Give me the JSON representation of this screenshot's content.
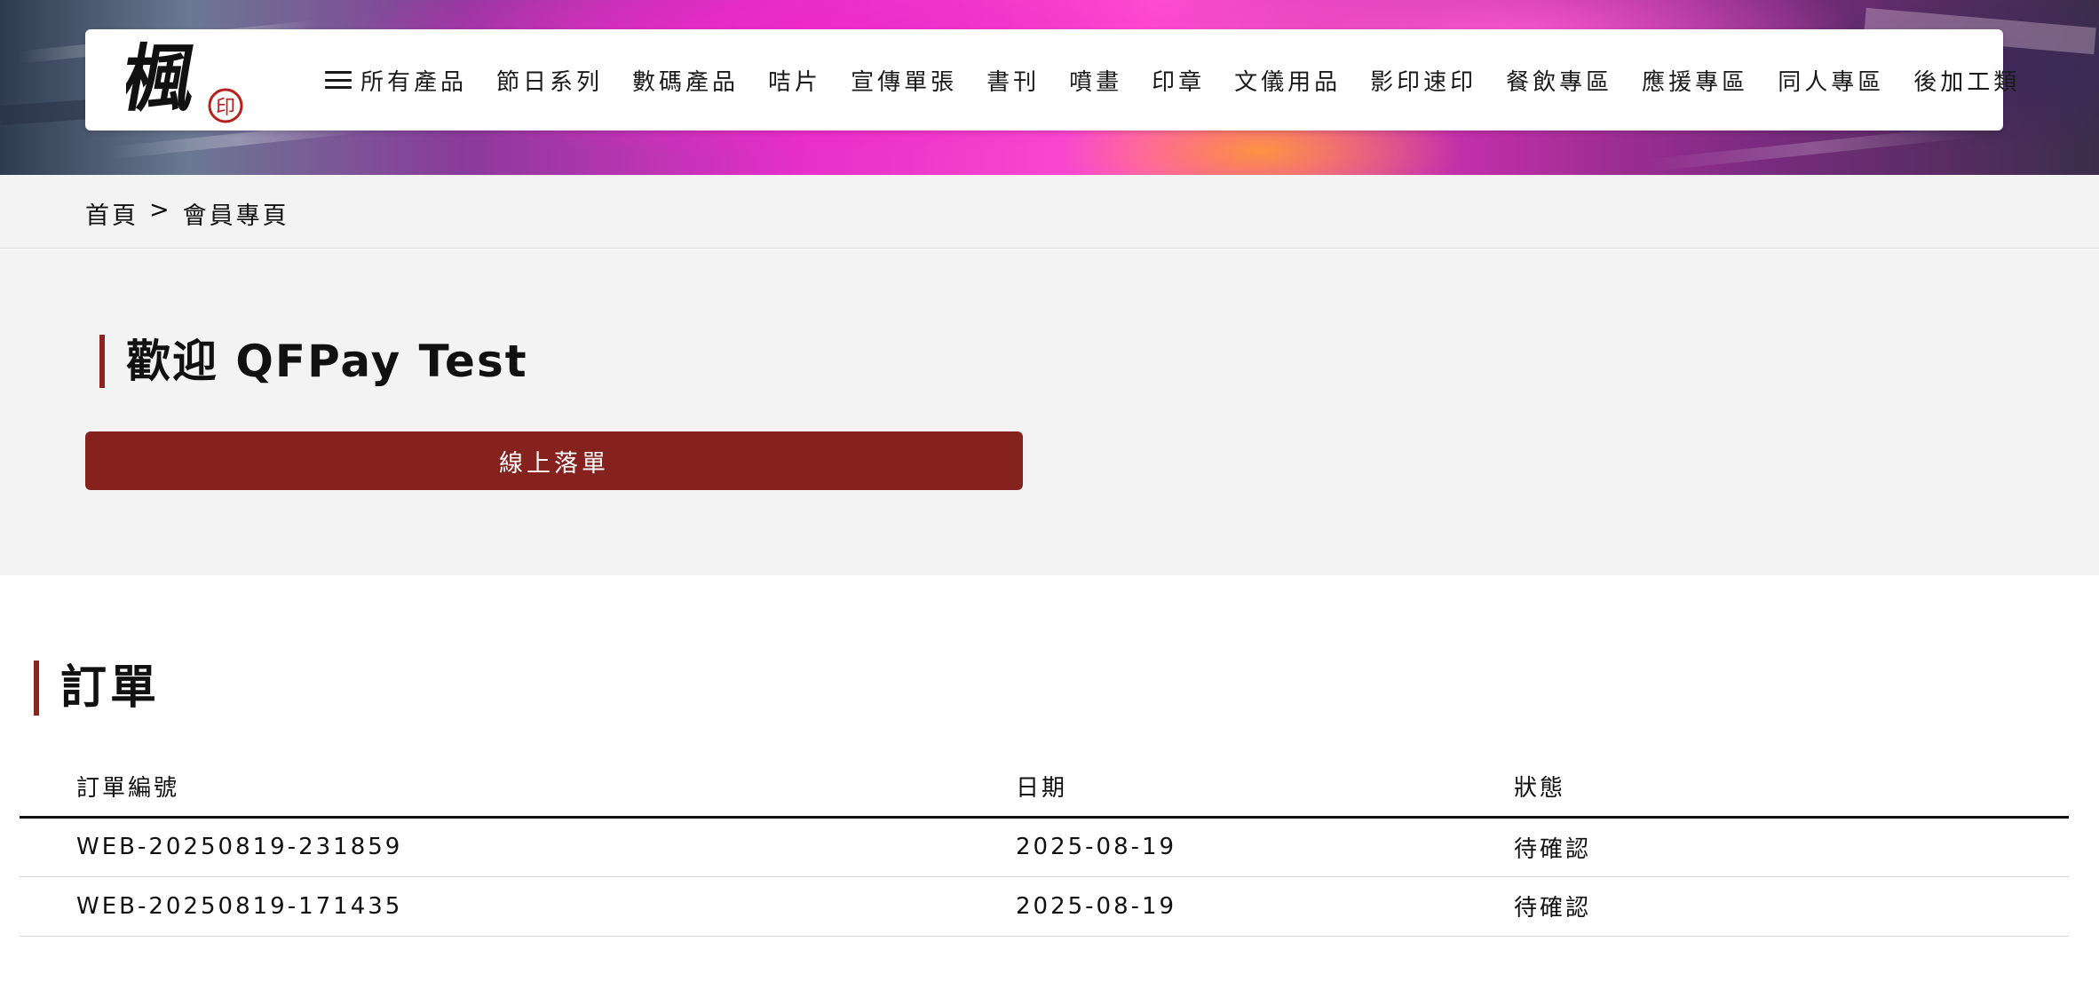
{
  "header": {
    "logo_text": "楓",
    "logo_badge": "印",
    "nav": [
      {
        "label": "所有產品",
        "icon": "menu-icon"
      },
      {
        "label": "節日系列"
      },
      {
        "label": "數碼產品"
      },
      {
        "label": "咭片"
      },
      {
        "label": "宣傳單張"
      },
      {
        "label": "書刊"
      },
      {
        "label": "噴畫"
      },
      {
        "label": "印章"
      },
      {
        "label": "文儀用品"
      },
      {
        "label": "影印速印"
      },
      {
        "label": "餐飲專區"
      },
      {
        "label": "應援專區"
      },
      {
        "label": "同人專區"
      },
      {
        "label": "後加工類"
      }
    ]
  },
  "breadcrumb": {
    "home": "首頁",
    "separator": ">",
    "current": "會員專頁"
  },
  "welcome": {
    "title": "歡迎 QFPay Test",
    "button_label": "線上落單"
  },
  "orders": {
    "title": "訂單",
    "columns": [
      "訂單編號",
      "日期",
      "狀態"
    ],
    "rows": [
      {
        "id": "WEB-20250819-231859",
        "date": "2025-08-19",
        "status": "待確認"
      },
      {
        "id": "WEB-20250819-171435",
        "date": "2025-08-19",
        "status": "待確認"
      }
    ]
  },
  "colors": {
    "accent": "#86221e",
    "section_bg": "#f3f3f3"
  }
}
